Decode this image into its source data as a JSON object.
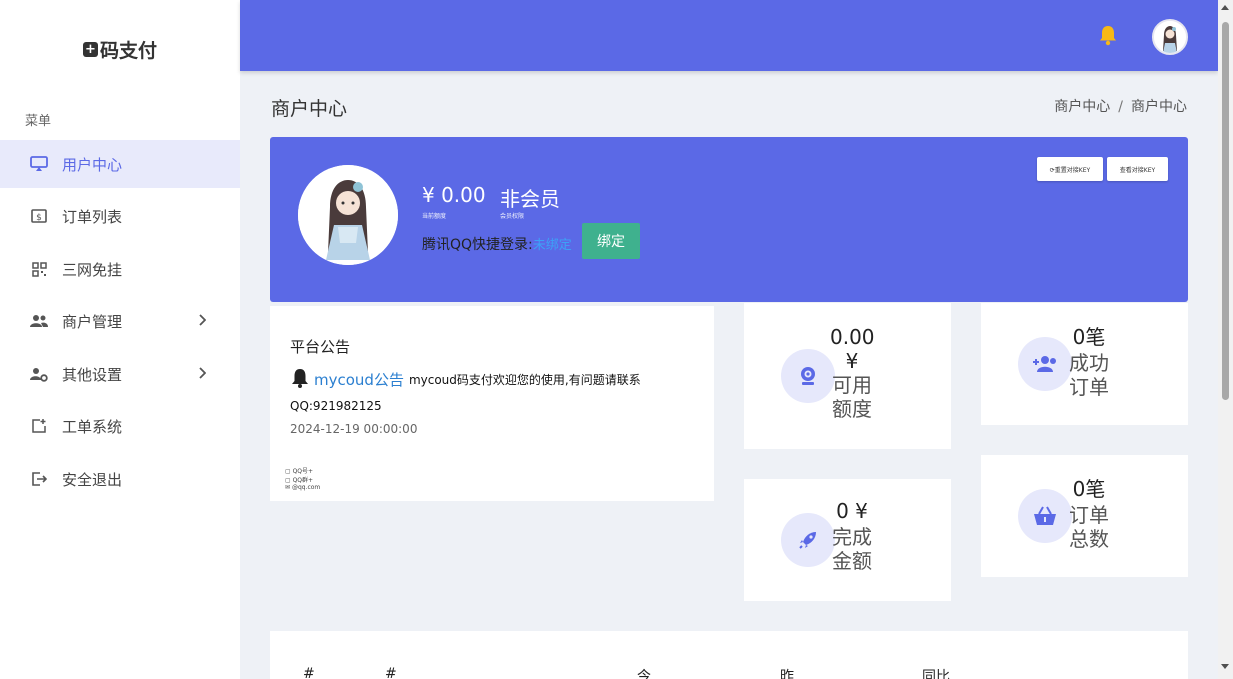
{
  "brand": {
    "logo_text": "码支付",
    "logo_icon": "plus-box-icon"
  },
  "sidebar": {
    "menu_title": "菜单",
    "items": [
      {
        "label": "用户中心",
        "icon": "monitor-icon",
        "active": true
      },
      {
        "label": "订单列表",
        "icon": "dollar-card-icon"
      },
      {
        "label": "三网免挂",
        "icon": "qrcode-icon"
      },
      {
        "label": "商户管理",
        "icon": "users-icon",
        "has_children": true
      },
      {
        "label": "其他设置",
        "icon": "user-gear-icon",
        "has_children": true
      },
      {
        "label": "工单系统",
        "icon": "ticket-add-icon"
      },
      {
        "label": "安全退出",
        "icon": "logout-icon"
      }
    ]
  },
  "header": {
    "bell_icon": "bell-icon",
    "bell_color": "#f7b916",
    "accent": "#5b69e6"
  },
  "page": {
    "title": "商户中心",
    "breadcrumb": [
      "商户中心",
      "商户中心"
    ],
    "breadcrumb_sep": "/"
  },
  "profile": {
    "balance": "¥ 0.00",
    "balance_label": "当前额度",
    "member": "非会员",
    "member_label": "会员权限",
    "qq_login_label": "腾讯QQ快捷登录:",
    "qq_status": "未绑定",
    "bind_button": "绑定",
    "reset_key_button": "⟳重置对接KEY",
    "view_key_button": "查看对接KEY"
  },
  "notice": {
    "title": "平台公告",
    "name": "mycoud公告",
    "message": "mycoud码支付欢迎您的使用,有问题请联系",
    "qq": "QQ:921982125",
    "date": "2024-12-19 00:00:00"
  },
  "contact": {
    "qq": "QQ号+",
    "qq_group": "QQ群+",
    "email": "@qq.com"
  },
  "stats": {
    "available_value": "0.00",
    "available_unit": "¥",
    "available_label": "可用额度",
    "success_value": "0笔",
    "success_label": "成功订单",
    "completed_value": "0 ¥",
    "completed_label": "完成金额",
    "total_value": "0笔",
    "total_label": "订单总数"
  },
  "table": {
    "headers": [
      "#",
      "#",
      "今",
      "昨",
      "同比"
    ]
  }
}
